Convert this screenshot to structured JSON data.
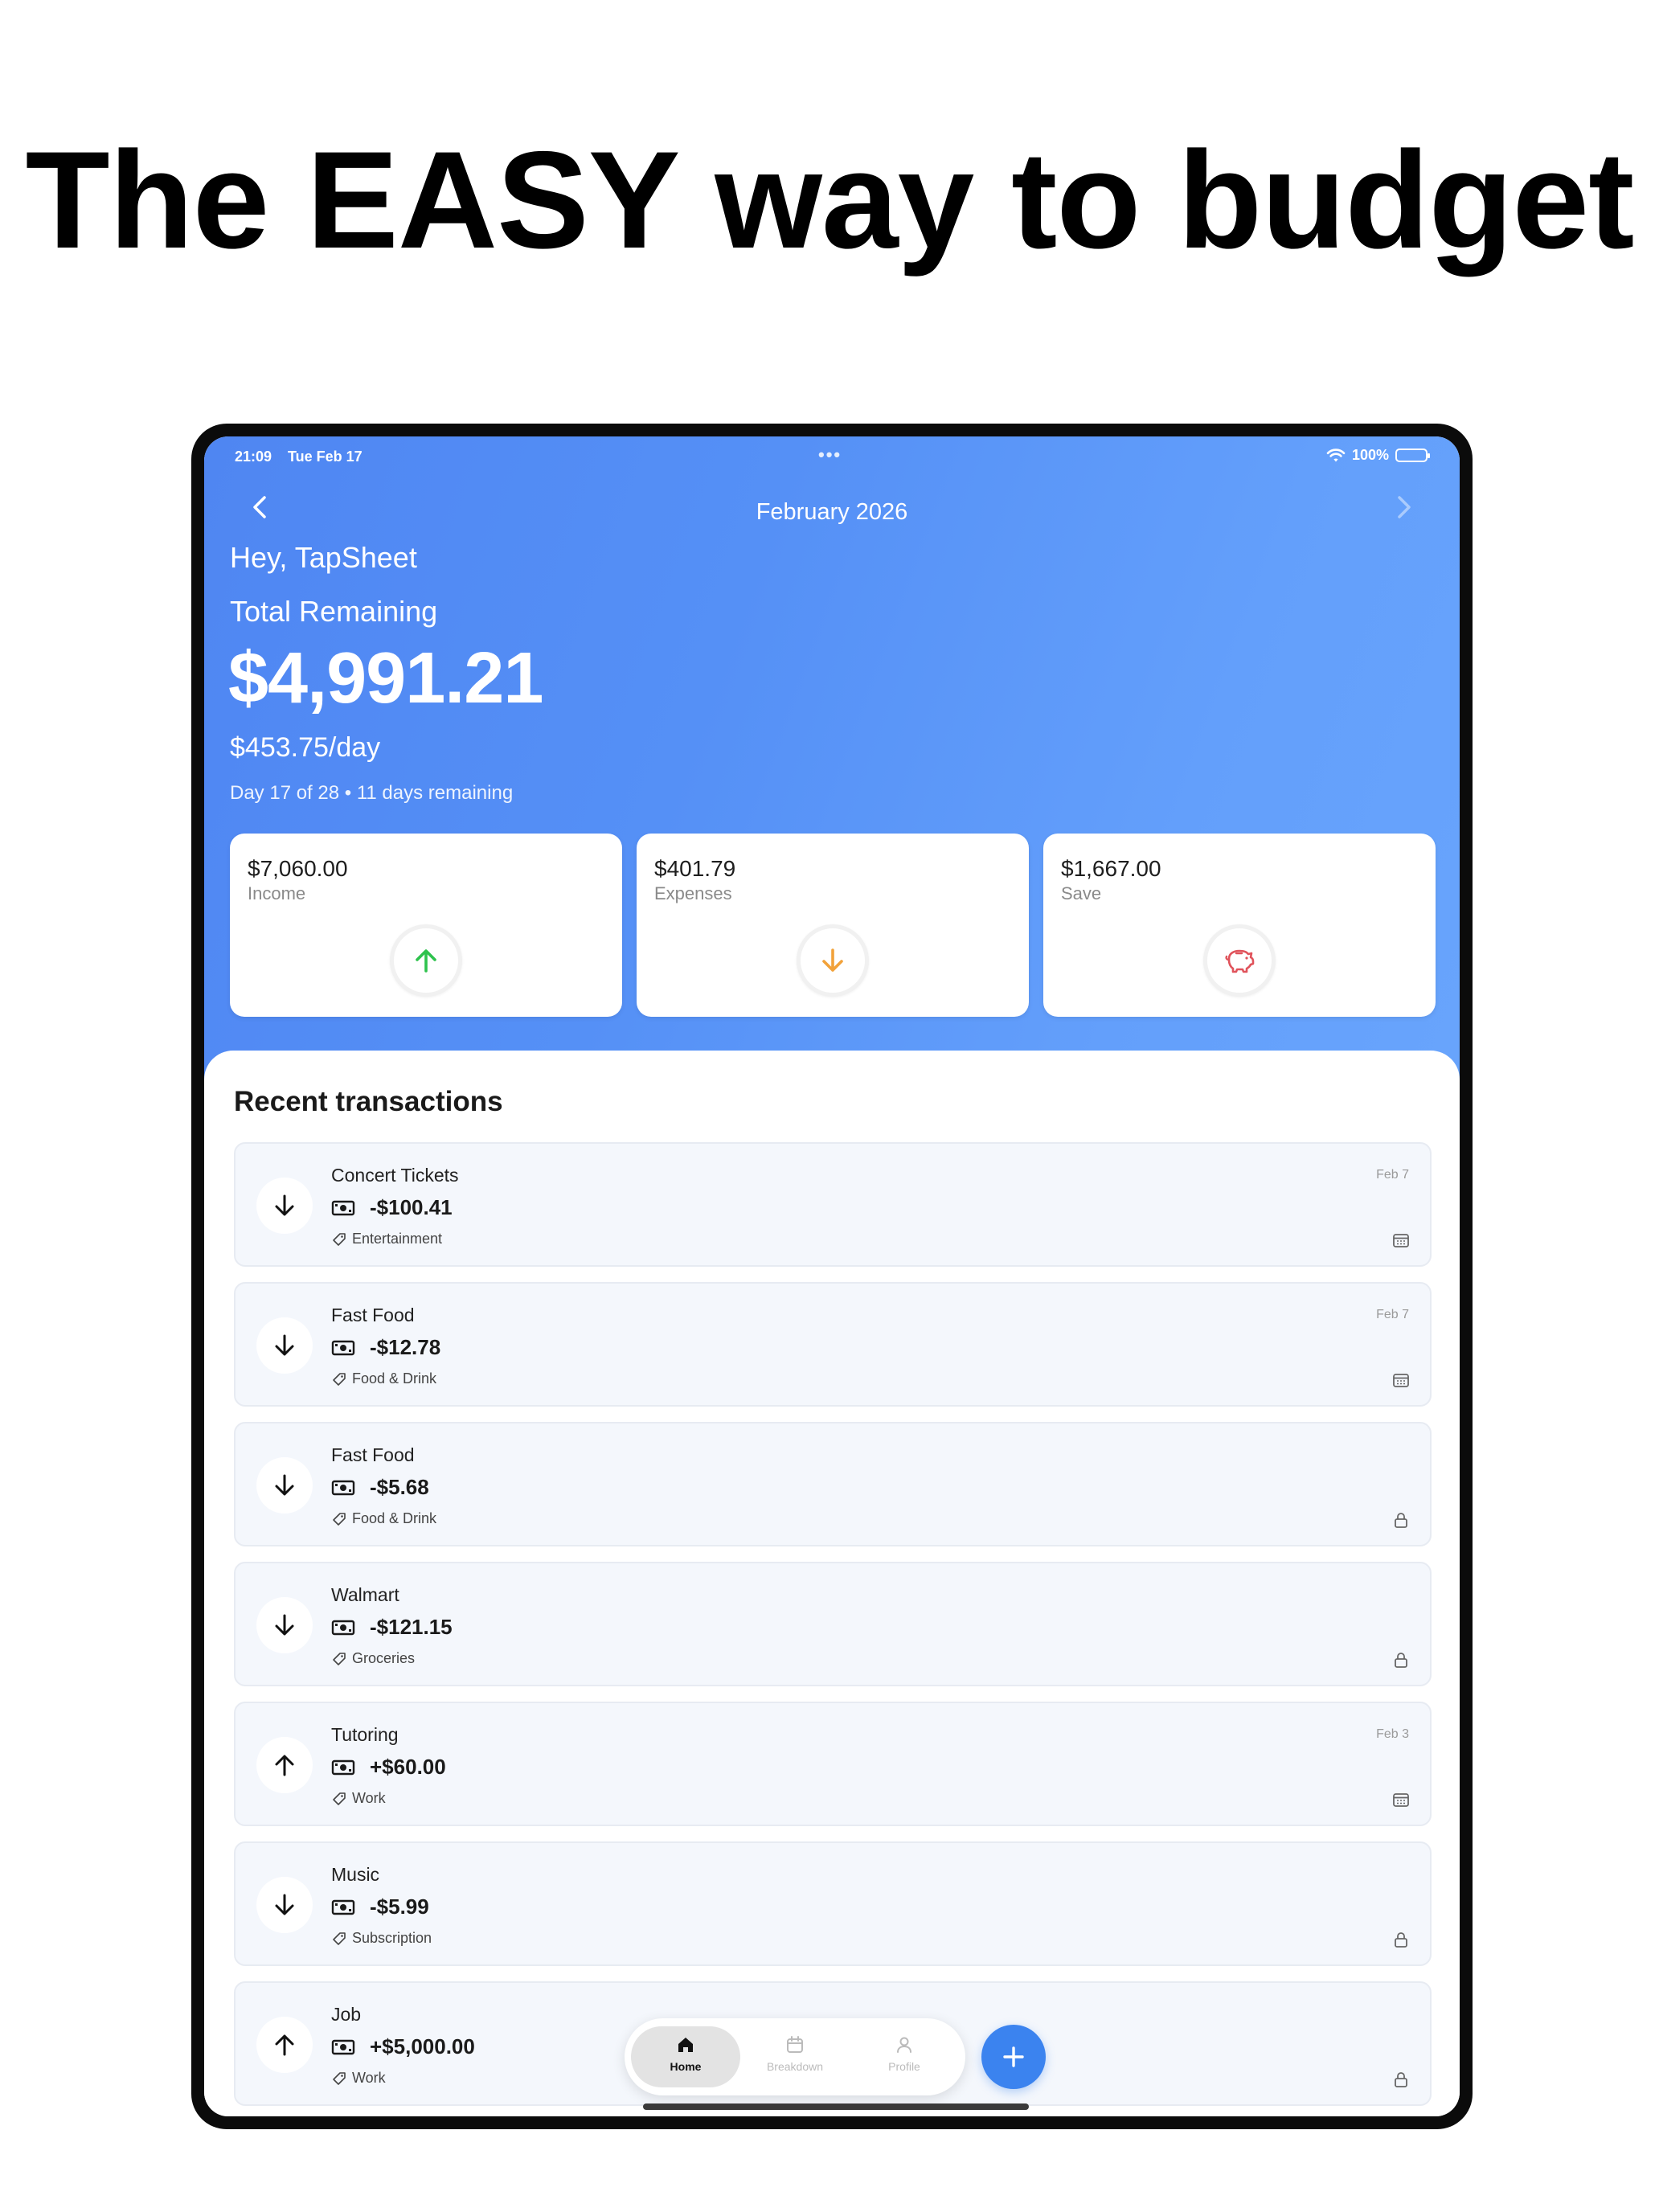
{
  "headline": "The EASY way to budget",
  "status_bar": {
    "time": "21:09",
    "date": "Tue Feb 17",
    "battery": "100%"
  },
  "header": {
    "month": "February 2026",
    "greeting": "Hey, TapSheet"
  },
  "summary": {
    "total_label": "Total Remaining",
    "total_amount": "$4,991.21",
    "per_day": "$453.75/day",
    "day_info": "Day 17 of 28 • 11 days remaining"
  },
  "cards": [
    {
      "amount": "$7,060.00",
      "label": "Income",
      "icon": "arrow-up-icon",
      "color": "#2ec24d"
    },
    {
      "amount": "$401.79",
      "label": "Expenses",
      "icon": "arrow-down-icon",
      "color": "#f2a23a"
    },
    {
      "amount": "$1,667.00",
      "label": "Save",
      "icon": "piggy-bank-icon",
      "color": "#e0535b"
    }
  ],
  "recent": {
    "title": "Recent transactions",
    "items": [
      {
        "name": "Concert Tickets",
        "amount": "-$100.41",
        "category": "Entertainment",
        "date": "Feb 7",
        "direction": "down",
        "status_icon": "calendar-icon"
      },
      {
        "name": "Fast Food",
        "amount": "-$12.78",
        "category": "Food & Drink",
        "date": "Feb 7",
        "direction": "down",
        "status_icon": "calendar-icon"
      },
      {
        "name": "Fast Food",
        "amount": "-$5.68",
        "category": "Food & Drink",
        "date": "",
        "direction": "down",
        "status_icon": "lock-icon"
      },
      {
        "name": "Walmart",
        "amount": "-$121.15",
        "category": "Groceries",
        "date": "",
        "direction": "down",
        "status_icon": "lock-icon"
      },
      {
        "name": "Tutoring",
        "amount": "+$60.00",
        "category": "Work",
        "date": "Feb 3",
        "direction": "up",
        "status_icon": "calendar-icon"
      },
      {
        "name": "Music",
        "amount": "-$5.99",
        "category": "Subscription",
        "date": "",
        "direction": "down",
        "status_icon": "lock-icon"
      },
      {
        "name": "Job",
        "amount": "+$5,000.00",
        "category": "Work",
        "date": "",
        "direction": "up",
        "status_icon": "lock-icon"
      }
    ]
  },
  "tabbar": {
    "home": "Home",
    "breakdown": "Breakdown",
    "profile": "Profile"
  }
}
